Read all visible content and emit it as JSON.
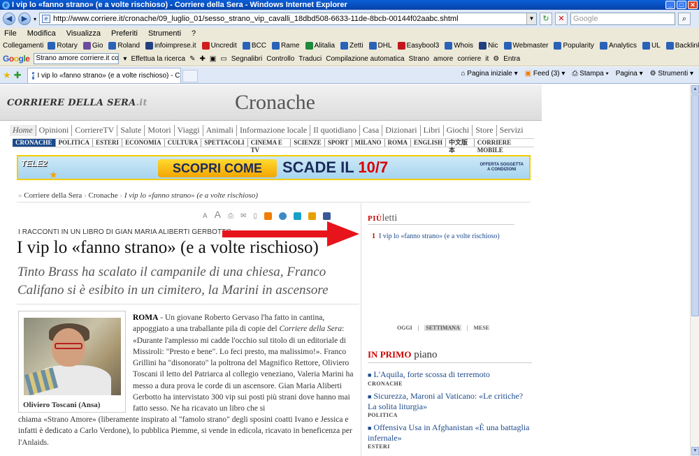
{
  "window": {
    "title": "I vip lo «fanno strano» (e a volte rischioso) - Corriere della Sera - Windows Internet Explorer"
  },
  "address": {
    "url": "http://www.corriere.it/cronache/09_luglio_01/sesso_strano_vip_cavalli_18dbd508-6633-11de-8bcb-00144f02aabc.shtml",
    "search_placeholder": "Google"
  },
  "menu": [
    "File",
    "Modifica",
    "Visualizza",
    "Preferiti",
    "Strumenti",
    "?"
  ],
  "links_bar": {
    "label": "Collegamenti",
    "items": [
      {
        "label": "Rotary",
        "color": "#2a62b8"
      },
      {
        "label": "Gio",
        "color": "#6b4ca0"
      },
      {
        "label": "Roland",
        "color": "#2a62b8"
      },
      {
        "label": "infoimprese.it",
        "color": "#22407f"
      },
      {
        "label": "Uncredit",
        "color": "#d11d1d"
      },
      {
        "label": "BCC",
        "color": "#2a62b8"
      },
      {
        "label": "Rame",
        "color": "#2a62b8"
      },
      {
        "label": "Alitalia",
        "color": "#1b8a3c"
      },
      {
        "label": "Zetti",
        "color": "#2a62b8"
      },
      {
        "label": "DHL",
        "color": "#2a62b8"
      },
      {
        "label": "Easybool3",
        "color": "#c4161c"
      },
      {
        "label": "Whois",
        "color": "#2a62b8"
      },
      {
        "label": "Nic",
        "color": "#22407f"
      },
      {
        "label": "Webmaster",
        "color": "#2a62b8"
      },
      {
        "label": "Popularity",
        "color": "#2a62b8"
      },
      {
        "label": "Analytics",
        "color": "#2a62b8"
      },
      {
        "label": "UL",
        "color": "#2a62b8"
      },
      {
        "label": "Backlink",
        "color": "#2a62b8"
      }
    ]
  },
  "google_bar": {
    "logo": "Google",
    "query": "Strano amore corriere.it comme",
    "items": [
      "Effettua la ricerca",
      "Segnalibri",
      "Controllo",
      "Traduci",
      "Compilazione automatica",
      "Strano",
      "amore",
      "corriere",
      "it",
      "Entra"
    ]
  },
  "tab": {
    "title": "I vip lo «fanno strano» (e a volte rischioso) - Corriere ..."
  },
  "tab_tools": [
    "Pagina iniziale",
    "Feed (3)",
    "Stampa",
    "Pagina",
    "Strumenti"
  ],
  "masthead": {
    "logo_main": "CORRIERE DELLA SERA",
    "logo_suffix": ".it",
    "section": "Cronache"
  },
  "nav_primary": [
    "Home",
    "Opinioni",
    "CorriereTV",
    "Salute",
    "Motori",
    "Viaggi",
    "Animali",
    "Informazione locale",
    "Il quotidiano",
    "Casa",
    "Dizionari",
    "Libri",
    "Giochi",
    "Store",
    "Servizi"
  ],
  "nav_secondary": [
    "CRONACHE",
    "POLITICA",
    "ESTERI",
    "ECONOMIA",
    "CULTURA",
    "SPETTACOLI",
    "CINEMA E TV",
    "SCIENZE",
    "SPORT",
    "MILANO",
    "ROMA",
    "ENGLISH",
    "中文版本",
    "CORRIERE MOBILE"
  ],
  "banner": {
    "brand": "TELE2",
    "cta": "SCOPRI COME",
    "scade": "SCADE IL ",
    "date": "10/7",
    "offer_line1": "OFFERTA SOGGETTA",
    "offer_line2": "A CONDIZIONI"
  },
  "breadcrumb": {
    "home": "Corriere della Sera",
    "section": "Cronache",
    "current": "I vip lo «fanno strano» (e a volte rischioso)"
  },
  "article": {
    "kicker": "I RACCONTI IN UN LIBRO DI GIAN MARIA ALIBERTI GERBOTTO",
    "headline": "I vip lo «fanno strano» (e a volte rischioso)",
    "subhead": "Tinto Brass ha scalato il campanile di una chiesa, Franco Califano si è esibito in un cimitero, la Marini in ascensore",
    "photo_caption": "Oliviero Toscani (Ansa)",
    "dateline": "ROMA",
    "body_part1": " - Un giovane Roberto Gervaso l'ha fatto in cantina, appoggiato a una traballante pila di copie del ",
    "body_newspaper": "Corriere della Sera",
    "body_part2": ": «Durante l'amplesso mi cadde l'occhio sul titolo di un editoriale di Missiroli: \"Presto e bene\". Lo feci presto, ma malissimo!». Franco Grillini ha \"disonorato\" la poltrona del Magnifico Rettore, Oliviero Toscani il letto del Patriarca al collegio veneziano, Valeria Marini ha messo a dura prova le corde di un ascensore. Gian Maria Aliberti Gerbotto ha intervistato 300 vip sui posti più strani dove hanno mai fatto sesso. Ne ha ricavato un libro che si",
    "body_full": "chiama «Strano Amore» (liberamente inspirato al \"famolo strano\" degli sposini coatti Ivano e Jessica e infatti è dedicato a Carlo Verdone), lo pubblica Piemme, si vende in edicola, ricavato in beneficenza per l'Anlaids."
  },
  "sidebar": {
    "piu_red": "PIÙ",
    "piu_rest": "letti",
    "most_read": [
      {
        "num": "1",
        "title": "I vip lo «fanno strano» (e a volte rischioso)"
      }
    ],
    "periods": [
      "OGGI",
      "SETTIMANA",
      "MESE"
    ],
    "primo_red": "IN PRIMO",
    "primo_rest": " piano",
    "primo_items": [
      {
        "title": "L'Aquila, forte scossa di terremoto",
        "category": "CRONACHE"
      },
      {
        "title": "Sicurezza, Maroni al Vaticano: «Le critiche? La solita liturgia»",
        "category": "POLITICA"
      },
      {
        "title": "Offensiva Usa in Afghanistan «È una battaglia infernale»",
        "category": "ESTERI"
      }
    ]
  },
  "colors": {
    "link_blue": "#1c4a8c",
    "accent_red": "#cc0000",
    "annotation_arrow": "#e8141b"
  }
}
